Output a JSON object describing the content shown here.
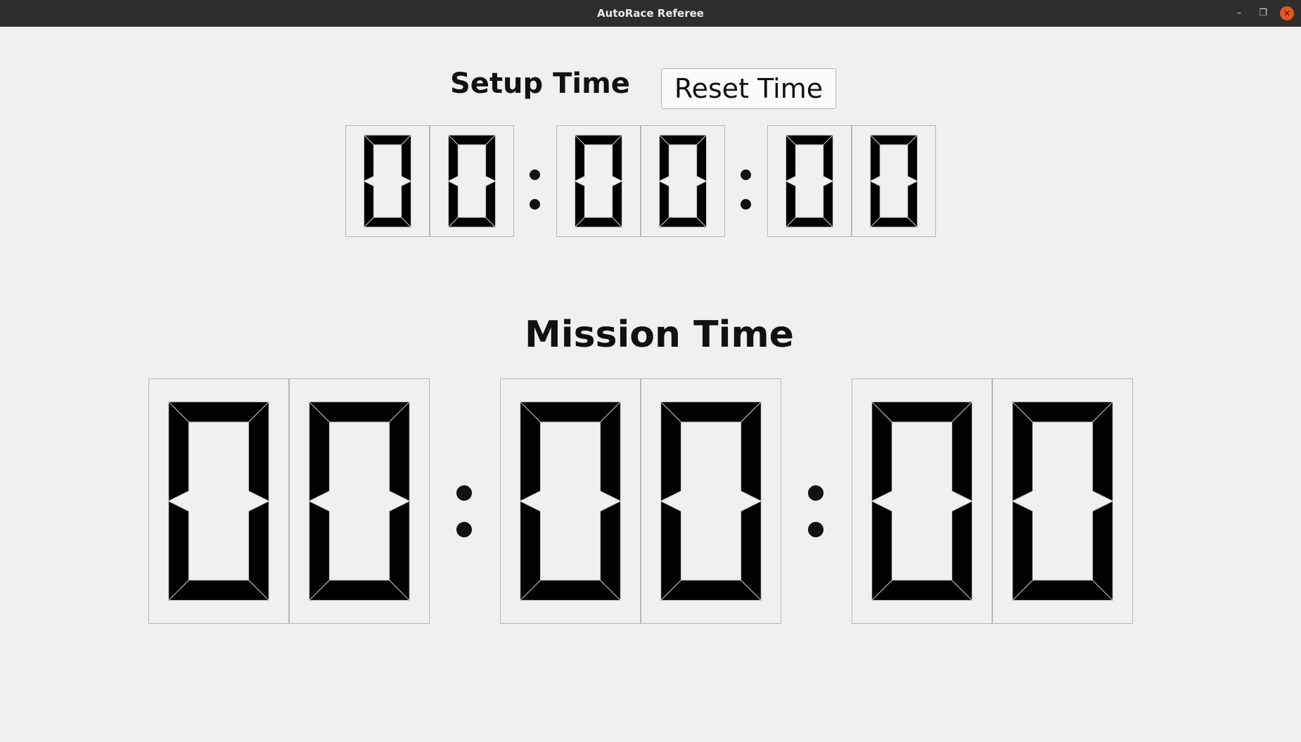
{
  "window": {
    "title": "AutoRace Referee",
    "controls": {
      "minimize": "–",
      "maximize": "❐",
      "close": "✕"
    }
  },
  "setup": {
    "heading": "Setup Time",
    "reset_button_label": "Reset Time",
    "display": "00:00:00",
    "digits": [
      "0",
      "0",
      "0",
      "0",
      "0",
      "0"
    ]
  },
  "mission": {
    "heading": "Mission Time",
    "display": "00:00:00",
    "digits": [
      "0",
      "0",
      "0",
      "0",
      "0",
      "0"
    ]
  },
  "colors": {
    "background": "#f0f0f0",
    "titlebar": "#2f2e2e",
    "close_button": "#e95420",
    "segment": "#000000"
  }
}
